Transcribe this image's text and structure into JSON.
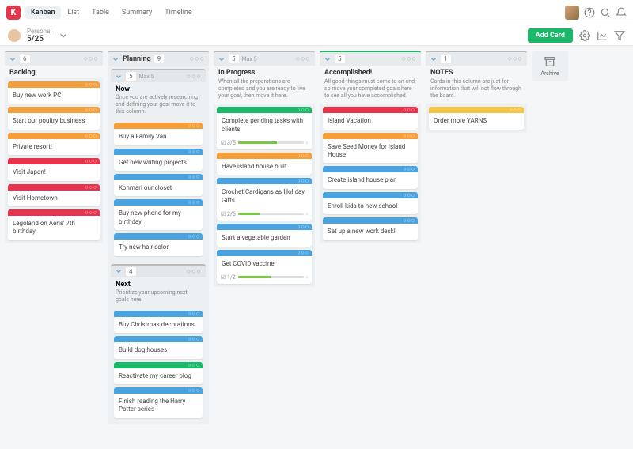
{
  "top": {
    "logo": "K",
    "views": [
      "Kanban",
      "List",
      "Table",
      "Summary",
      "Timeline"
    ],
    "activeView": 0
  },
  "sub": {
    "personalLabel": "Personal",
    "count": "5/25",
    "addCard": "Add Card"
  },
  "archive": {
    "label": "Archive"
  },
  "cols": [
    {
      "count": "6",
      "title": "Backlog",
      "desc": "",
      "cards": [
        {
          "color": "orange",
          "text": "Buy new work PC"
        },
        {
          "color": "orange",
          "text": "Start our poultry business"
        },
        {
          "color": "orange",
          "text": "Private resort!"
        },
        {
          "color": "red",
          "text": "Visit Japan!"
        },
        {
          "color": "red",
          "text": "Visit Hometown"
        },
        {
          "color": "red",
          "text": "Legoland on Aeris' 7th birthday"
        }
      ]
    },
    {
      "groupTitle": "Planning",
      "groupCount": "9",
      "sub": [
        {
          "count": "5",
          "max": "Max 5",
          "title": "Now",
          "desc": "Once you are actively researching and defining your goal move it to this column.",
          "cards": [
            {
              "color": "orange",
              "text": "Buy a Family Van"
            },
            {
              "color": "blue",
              "text": "Get new writing projects"
            },
            {
              "color": "blue",
              "text": "Konmari our closet"
            },
            {
              "color": "blue",
              "text": "Buy new phone for my birthday"
            },
            {
              "color": "blue",
              "text": "Try new hair color"
            }
          ]
        },
        {
          "count": "4",
          "title": "Next",
          "desc": "Prioritize your upcoming next goals here.",
          "cards": [
            {
              "color": "blue",
              "text": "Buy Christmas decorations"
            },
            {
              "color": "blue",
              "text": "Build dog houses"
            },
            {
              "color": "green",
              "text": "Reactivate my career blog"
            },
            {
              "color": "blue",
              "text": "Finish reading the Harry Potter series"
            }
          ]
        }
      ]
    },
    {
      "count": "5",
      "max": "Max 5",
      "title": "In Progress",
      "desc": "When all the preparations are completed and you are ready to live your goal, then move it here.",
      "cards": [
        {
          "color": "green",
          "text": "Complete pending tasks with clients",
          "sub": "3/5",
          "pct": 60
        },
        {
          "color": "orange",
          "text": "Have island house built"
        },
        {
          "color": "blue",
          "text": "Crochet Cardigans as Holiday Gifts",
          "sub": "2/6",
          "pct": 33
        },
        {
          "color": "blue",
          "text": "Start a vegetable garden"
        },
        {
          "color": "blue",
          "text": "Get COVID vaccine",
          "sub": "1/2",
          "pct": 50
        }
      ]
    },
    {
      "count": "5",
      "title": "Accomplished!",
      "desc": "All good things must come to an end, so move your completed goals here to see all you have accomplished.",
      "cards": [
        {
          "color": "red",
          "text": "Island Vacation"
        },
        {
          "color": "orange",
          "text": "Save Seed Money for Island House"
        },
        {
          "color": "blue",
          "text": "Create island house plan"
        },
        {
          "color": "blue",
          "text": "Enroll kids to new school"
        },
        {
          "color": "blue",
          "text": "Set up a new work desk!"
        }
      ]
    },
    {
      "count": "1",
      "title": "NOTES",
      "desc": "Cards in this column are just for information that will not flow through the board.",
      "cards": [
        {
          "color": "yellow",
          "text": "Order more YARNS"
        }
      ]
    }
  ]
}
